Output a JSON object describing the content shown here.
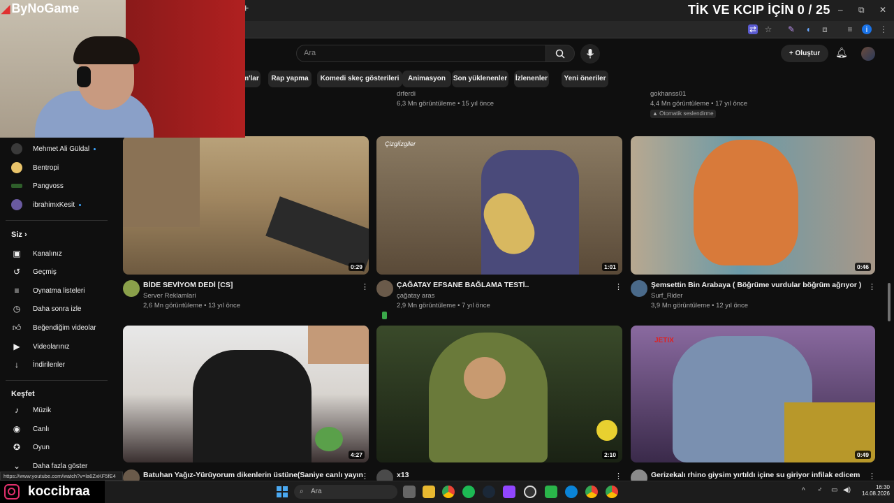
{
  "overlay": {
    "brand": "ByNoGame",
    "goal_text": "TİK VE KCIP İÇİN 0 / 25",
    "streamer": "koccibraa"
  },
  "browser": {
    "new_tab": "+",
    "minimize": "–",
    "maximize": "⧉",
    "close": "✕"
  },
  "header": {
    "search_placeholder": "Ara",
    "create_label": "Oluştur"
  },
  "chips": [
    "m'lar",
    "Rap yapma",
    "Komedi skeç gösterileri",
    "Animasyon",
    "Son yüklenenler",
    "İzlenenler",
    "Yeni öneriler"
  ],
  "top_row": [
    {
      "channel": "drferdi",
      "meta": "6,3 Mn görüntüleme • 15 yıl önce"
    },
    {
      "channel": "gokhanss01",
      "meta": "4,4 Mn görüntüleme • 17 yıl önce",
      "badge": "Otomatik seslendirme"
    }
  ],
  "sidebar": {
    "subscriptions": [
      {
        "name": "Mehmet Ali Güldal",
        "live_dot": true
      },
      {
        "name": "Bentropi",
        "live_dot": false
      },
      {
        "name": "Pangvoss",
        "live_dot": false
      },
      {
        "name": "ibrahimxKesit",
        "live_dot": true
      }
    ],
    "you_heading": "Siz",
    "you_items": [
      "Kanalınız",
      "Geçmiş",
      "Oynatma listeleri",
      "Daha sonra izle",
      "Beğendiğim videolar",
      "Videolarınız",
      "İndirilenler"
    ],
    "explore_heading": "Keşfet",
    "explore_items": [
      "Müzik",
      "Canlı",
      "Oyun",
      "Daha fazla göster"
    ]
  },
  "videos": [
    {
      "title": "BİDE SEVİYOM DEDİ [CS]",
      "channel": "Server Reklamlari",
      "meta": "2,6 Mn görüntüleme • 13 yıl önce",
      "duration": "0:29"
    },
    {
      "title": "ÇAĞATAY EFSANE BAĞLAMA TESTİ..",
      "channel": "çağatay aras",
      "meta": "2,9 Mn görüntüleme • 7 yıl önce",
      "duration": "1:01",
      "thumb_caption": "Çizgiİzgiler"
    },
    {
      "title": "Şemsettin Bin Arabaya ( Böğrüme vurdular böğrüm ağrıyor )",
      "channel": "Surf_Rider",
      "meta": "3,9 Mn görüntüleme • 12 yıl önce",
      "duration": "0:46"
    },
    {
      "title": "Batuhan Yağız-Yürüyorum dikenlerin üstüne(Saniye canlı yayın",
      "duration": "4:27"
    },
    {
      "title": "x13",
      "duration": "2:10"
    },
    {
      "title": "Gerizekalı rhino giysim yırtıldı içine su giriyor infilak edicem",
      "duration": "0:49",
      "thumb_caption": "JETIX"
    }
  ],
  "status_url": "https://www.youtube.com/watch?v=la6ZxKF5fE4",
  "taskbar": {
    "search": "Ara",
    "time": "16:30",
    "date": "14.08.2026"
  },
  "colors": {
    "bg": "#0f0f0f",
    "chip": "#272727",
    "accent_blue": "#3ea6ff",
    "insta": "#e1306c"
  }
}
